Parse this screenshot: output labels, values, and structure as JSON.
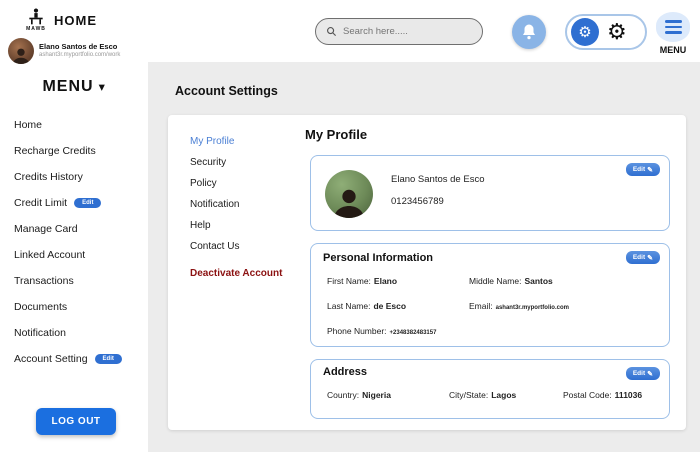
{
  "topbar": {
    "logo_text": "MAWB",
    "home_label": "HOME",
    "search_placeholder": "Search here.....",
    "menu_label": "MENU"
  },
  "user_chip": {
    "name": "Elano Santos de Esco",
    "subtitle": "ashant3r.myportfolio.com/work"
  },
  "sidebar": {
    "menu_label": "MENU",
    "items": [
      {
        "label": "Home"
      },
      {
        "label": "Recharge Credits"
      },
      {
        "label": "Credits History"
      },
      {
        "label": "Credit Limit",
        "badge": "Edit"
      },
      {
        "label": "Manage Card"
      },
      {
        "label": "Linked Account"
      },
      {
        "label": "Transactions"
      },
      {
        "label": "Documents"
      },
      {
        "label": "Notification"
      },
      {
        "label": "Account Setting",
        "badge": "Edit"
      }
    ],
    "logout_label": "LOG OUT"
  },
  "main": {
    "page_title": "Account Settings",
    "subnav": [
      {
        "label": "My Profile"
      },
      {
        "label": "Security"
      },
      {
        "label": "Policy"
      },
      {
        "label": "Notification"
      },
      {
        "label": "Help"
      },
      {
        "label": "Contact Us"
      },
      {
        "label": "Deactivate Account"
      }
    ],
    "section_title": "My Profile",
    "edit_label": "Edit",
    "profile_card": {
      "name": "Elano Santos de Esco",
      "phone": "0123456789"
    },
    "personal_info": {
      "title": "Personal Information",
      "first_name_label": "First Name:",
      "first_name": "Elano",
      "middle_name_label": "Middle Name:",
      "middle_name": "Santos",
      "last_name_label": "Last Name:",
      "last_name": "de Esco",
      "email_label": "Email:",
      "email": "ashant3r.myportfolio.com",
      "phone_label": "Phone Number:",
      "phone": "+2348382483157"
    },
    "address": {
      "title": "Address",
      "country_label": "Country:",
      "country": "Nigeria",
      "city_label": "City/State:",
      "city": "Lagos",
      "postal_label": "Postal Code:",
      "postal": "111036"
    }
  }
}
